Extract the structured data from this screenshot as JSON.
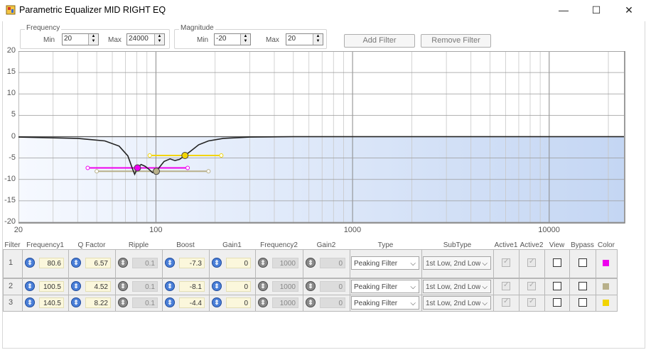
{
  "window": {
    "title": "Parametric Equalizer MID RIGHT EQ",
    "minimize_glyph": "—",
    "maximize_glyph": "☐",
    "close_glyph": "✕"
  },
  "frequency_group": {
    "title": "Frequency",
    "min_label": "Min",
    "min_value": "20",
    "max_label": "Max",
    "max_value": "24000"
  },
  "magnitude_group": {
    "title": "Magnitude",
    "min_label": "Min",
    "min_value": "-20",
    "max_label": "Max",
    "max_value": "20"
  },
  "buttons": {
    "add": "Add Filter",
    "remove": "Remove Filter"
  },
  "chart_data": {
    "type": "line",
    "title": "",
    "xlabel": "",
    "ylabel": "",
    "x_scale": "log",
    "xlim": [
      20,
      24000
    ],
    "ylim": [
      -20,
      20
    ],
    "x_tick_labels": [
      "20",
      "100",
      "1000",
      "10000"
    ],
    "x_tick_values": [
      20,
      100,
      1000,
      10000
    ],
    "y_tick_labels": [
      "20",
      "15",
      "10",
      "5",
      "0",
      "-5",
      "-10",
      "-15",
      "-20"
    ],
    "y_tick_values": [
      20,
      15,
      10,
      5,
      0,
      -5,
      -10,
      -15,
      -20
    ],
    "grid": true,
    "response": {
      "name": "",
      "x": [
        20,
        40,
        55,
        65,
        72,
        76,
        78,
        80.6,
        84,
        88,
        92,
        96,
        100.5,
        104,
        110,
        118,
        125,
        132,
        140.5,
        150,
        165,
        185,
        220,
        300,
        500,
        1000,
        5000,
        24000
      ],
      "y": [
        -0.1,
        -0.4,
        -1.0,
        -2.2,
        -4.5,
        -7.5,
        -8.8,
        -7.3,
        -6.5,
        -6.9,
        -7.6,
        -8.4,
        -8.2,
        -7.2,
        -5.8,
        -5.2,
        -5.6,
        -5.3,
        -4.4,
        -3.4,
        -1.9,
        -1.0,
        -0.4,
        -0.1,
        0,
        0,
        0,
        0
      ]
    },
    "filter_markers": [
      {
        "frequency": 80.6,
        "gain": -7.3,
        "band_low": 45,
        "band_high": 145,
        "color": "#ee00ee"
      },
      {
        "frequency": 100.5,
        "gain": -8.1,
        "band_low": 50,
        "band_high": 185,
        "color": "#b8b08a"
      },
      {
        "frequency": 140.5,
        "gain": -4.4,
        "band_low": 93,
        "band_high": 215,
        "color": "#f2d400"
      }
    ],
    "fill_colors": [
      "#f6f9ff",
      "#c4d6f3"
    ]
  },
  "table": {
    "headers": [
      "Filter",
      "Frequency1",
      "Q Factor",
      "Ripple",
      "Boost",
      "Gain1",
      "Frequency2",
      "Gain2",
      "Type",
      "SubType",
      "Active1",
      "Active2",
      "View",
      "Bypass",
      "Color"
    ],
    "rows": [
      {
        "filter": "1",
        "frequency1": "80.6",
        "q_factor": "6.57",
        "ripple": "0.1",
        "boost": "-7.3",
        "gain1": "0",
        "frequency2": "1000",
        "gain2": "0",
        "type": "Peaking Filter",
        "subtype": "1st Low, 2nd Low",
        "color": "#ee00ee"
      },
      {
        "filter": "2",
        "frequency1": "100.5",
        "q_factor": "4.52",
        "ripple": "0.1",
        "boost": "-8.1",
        "gain1": "0",
        "frequency2": "1000",
        "gain2": "0",
        "type": "Peaking Filter",
        "subtype": "1st Low, 2nd Low",
        "color": "#b8b08a"
      },
      {
        "filter": "3",
        "frequency1": "140.5",
        "q_factor": "8.22",
        "ripple": "0.1",
        "boost": "-4.4",
        "gain1": "0",
        "frequency2": "1000",
        "gain2": "0",
        "type": "Peaking Filter",
        "subtype": "1st Low, 2nd Low",
        "color": "#f2d400"
      }
    ],
    "knob_glyph": "⇕",
    "dropdown_glyph": "⌵"
  },
  "icons": [
    "app-icon",
    "minimize-icon",
    "maximize-icon",
    "close-icon",
    "spin-arrows-icon",
    "knob-icon",
    "chevron-down-icon",
    "checkbox-icon"
  ]
}
